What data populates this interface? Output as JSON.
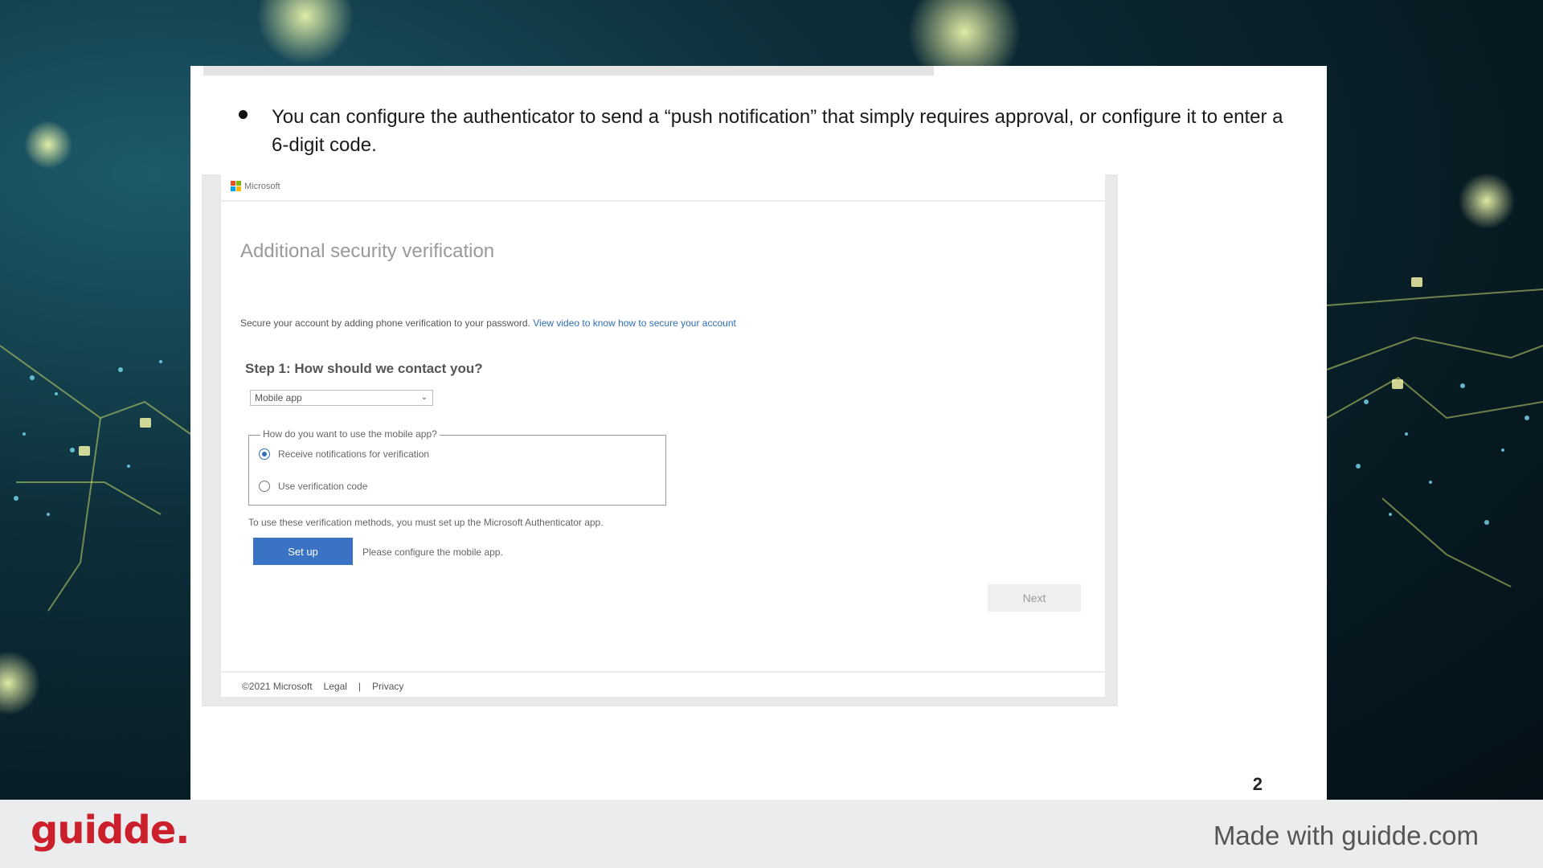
{
  "slide": {
    "bullet_text": "You can configure the authenticator to send a “push notification” that simply requires approval, or configure it to enter a 6-digit code.",
    "page_number": "2"
  },
  "ms_page": {
    "brand": "Microsoft",
    "logo_colors": [
      "#f25022",
      "#7fba00",
      "#00a4ef",
      "#ffb900"
    ],
    "title": "Additional security verification",
    "description": "Secure your account by adding phone verification to your password.",
    "video_link": "View video to know how to secure your account",
    "step_heading": "Step 1: How should we contact you?",
    "contact_method": "Mobile app",
    "mode_legend": "How do you want to use the mobile app?",
    "options": [
      {
        "label": "Receive notifications for verification",
        "selected": true
      },
      {
        "label": "Use verification code",
        "selected": false
      }
    ],
    "note": "To use these verification methods, you must set up the Microsoft Authenticator app.",
    "setup_button": "Set up",
    "setup_hint": "Please configure the mobile app.",
    "next_button": "Next",
    "footer": {
      "copyright": "©2021 Microsoft",
      "legal": "Legal",
      "separator": "|",
      "privacy": "Privacy"
    }
  },
  "branding": {
    "logo": "guidde.",
    "made_with": "Made with guidde.com",
    "logo_color": "#cc1f2c"
  }
}
